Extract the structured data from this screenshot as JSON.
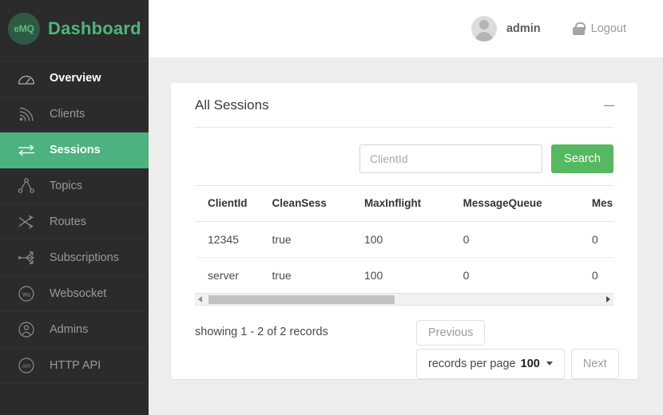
{
  "brand": {
    "logo_text": "eMQ",
    "title": "Dashboard"
  },
  "sidebar": {
    "items": [
      {
        "label": "Overview",
        "icon": "gauge-icon",
        "active": false,
        "strong": true
      },
      {
        "label": "Clients",
        "icon": "signal-icon",
        "active": false,
        "strong": false
      },
      {
        "label": "Sessions",
        "icon": "exchange-icon",
        "active": true,
        "strong": false
      },
      {
        "label": "Topics",
        "icon": "topic-tree-icon",
        "active": false,
        "strong": false
      },
      {
        "label": "Routes",
        "icon": "shuffle-icon",
        "active": false,
        "strong": false
      },
      {
        "label": "Subscriptions",
        "icon": "subscription-icon",
        "active": false,
        "strong": false
      },
      {
        "label": "Websocket",
        "icon": "websocket-icon",
        "active": false,
        "strong": false
      },
      {
        "label": "Admins",
        "icon": "user-circle-icon",
        "active": false,
        "strong": false
      },
      {
        "label": "HTTP API",
        "icon": "api-circle-icon",
        "active": false,
        "strong": false
      }
    ]
  },
  "header": {
    "user_name": "admin",
    "logout_label": "Logout",
    "avatar_icon": "user-avatar-icon",
    "lock_icon": "lock-icon"
  },
  "panel": {
    "title": "All Sessions",
    "minimize_icon": "minimize-icon"
  },
  "search": {
    "placeholder": "ClientId",
    "value": "",
    "button_label": "Search"
  },
  "table": {
    "columns": [
      "ClientId",
      "CleanSess",
      "MaxInflight",
      "MessageQueue",
      "MessageDr"
    ],
    "rows": [
      [
        "12345",
        "true",
        "100",
        "0",
        "0"
      ],
      [
        "server",
        "true",
        "100",
        "0",
        "0"
      ]
    ]
  },
  "footer": {
    "records_info": "showing 1 - 2 of 2 records",
    "previous_label": "Previous",
    "next_label": "Next",
    "records_per_page_label": "records per page",
    "records_per_page_value": "100"
  },
  "colors": {
    "sidebar_bg": "#2b2b2b",
    "accent_green": "#4cb280",
    "brand_green": "#4cb87a",
    "search_green": "#56b861",
    "content_bg": "#ededed"
  }
}
